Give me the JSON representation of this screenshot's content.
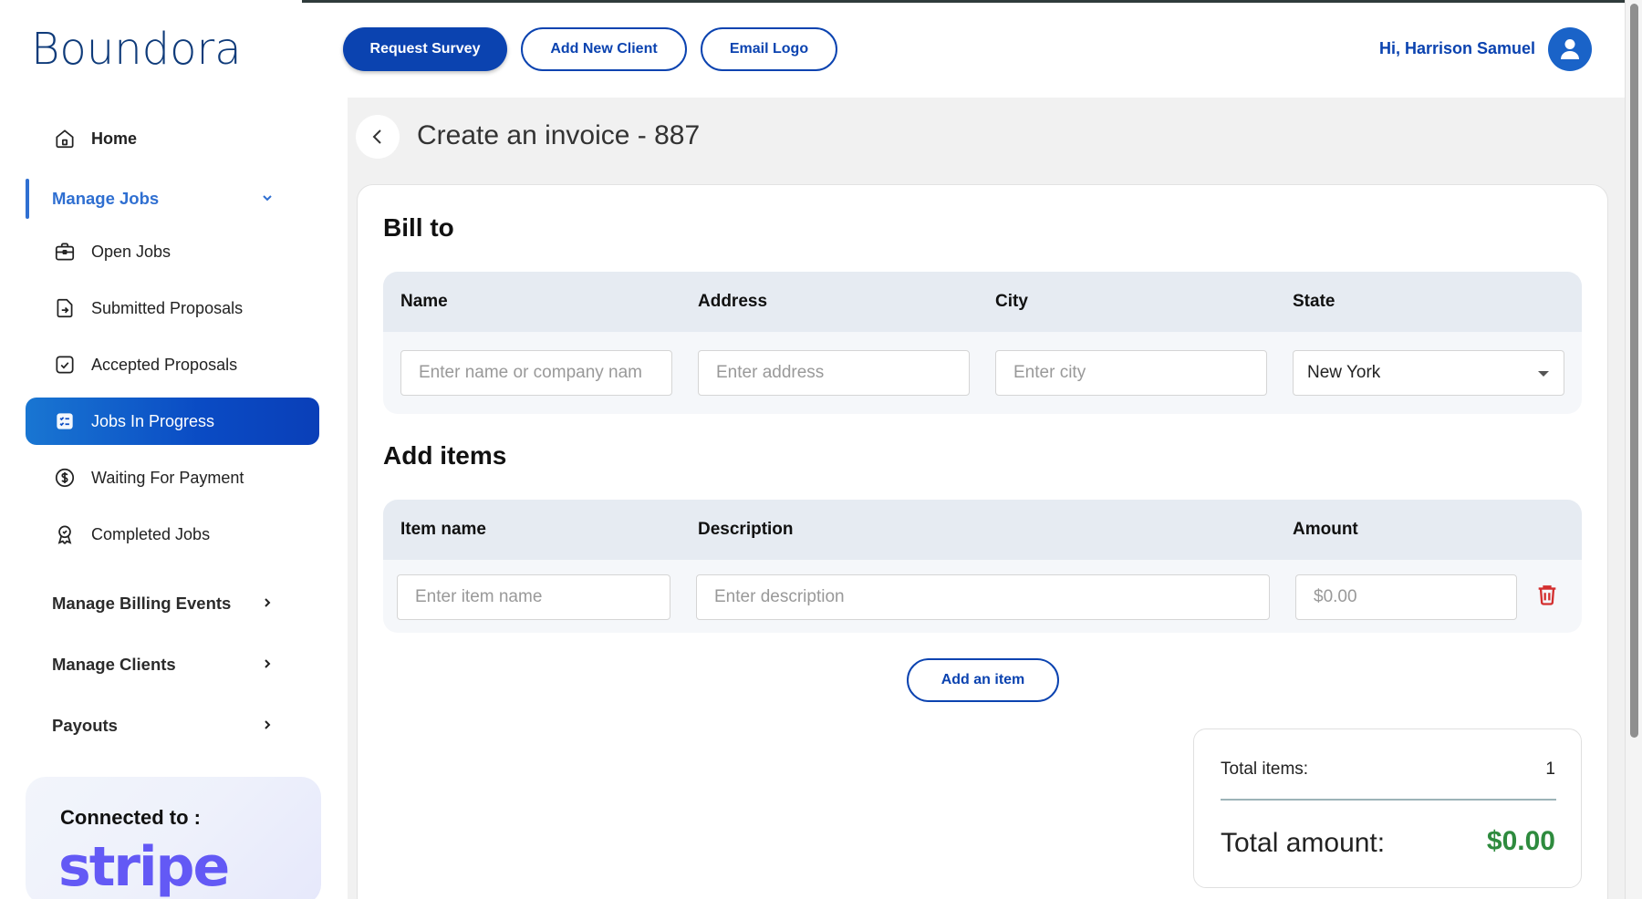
{
  "brand": {
    "name": "Boundora",
    "accent": "#0b43b0"
  },
  "header": {
    "buttons": {
      "request_survey": "Request Survey",
      "add_new_client": "Add New Client",
      "email_logo": "Email Logo"
    },
    "greeting": "Hi, Harrison Samuel"
  },
  "sidebar": {
    "home": "Home",
    "manage_jobs": "Manage Jobs",
    "jobs_items": [
      {
        "label": "Open Jobs",
        "icon": "briefcase-icon"
      },
      {
        "label": "Submitted Proposals",
        "icon": "file-arrow-icon"
      },
      {
        "label": "Accepted Proposals",
        "icon": "check-square-icon"
      },
      {
        "label": "Jobs In Progress",
        "icon": "checklist-icon"
      },
      {
        "label": "Waiting For Payment",
        "icon": "dollar-circle-icon"
      },
      {
        "label": "Completed Jobs",
        "icon": "award-icon"
      }
    ],
    "manage_billing_events": "Manage Billing Events",
    "manage_clients": "Manage Clients",
    "payouts": "Payouts",
    "connected_label": "Connected to :",
    "connected_service": "stripe"
  },
  "page": {
    "title": "Create an invoice - 887"
  },
  "bill_to": {
    "title": "Bill to",
    "columns": [
      "Name",
      "Address",
      "City",
      "State"
    ],
    "name_placeholder": "Enter name or company nam",
    "address_placeholder": "Enter address",
    "city_placeholder": "Enter city",
    "state_value": "New York"
  },
  "items": {
    "title": "Add items",
    "columns": [
      "Item name",
      "Description",
      "Amount"
    ],
    "item_placeholder": "Enter item name",
    "description_placeholder": "Enter description",
    "amount_placeholder": "$0.00",
    "add_button": "Add an item"
  },
  "totals": {
    "items_label": "Total items:",
    "items_value": "1",
    "amount_label": "Total amount:",
    "amount_value": "$0.00",
    "amount_color": "#2e8b3e"
  }
}
